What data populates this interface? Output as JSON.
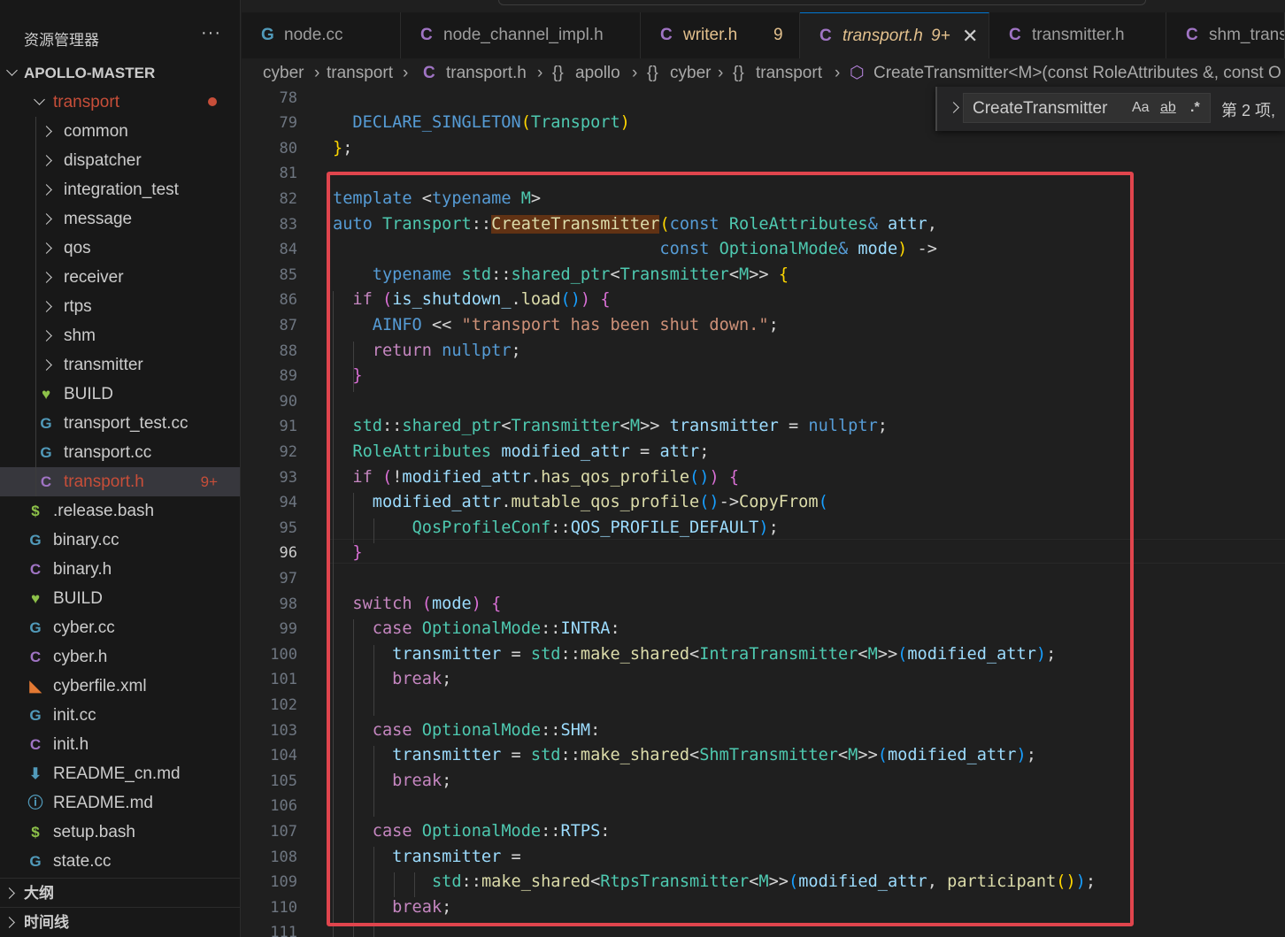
{
  "explorer": {
    "title": "资源管理器",
    "more": "···",
    "root": "APOLLO-MASTER",
    "items": [
      {
        "label": "transport",
        "icon": "folder-open",
        "badge": ""
      },
      {
        "label": "common",
        "icon": "folder",
        "badge": ""
      },
      {
        "label": "dispatcher",
        "icon": "folder",
        "badge": ""
      },
      {
        "label": "integration_test",
        "icon": "folder",
        "badge": ""
      },
      {
        "label": "message",
        "icon": "folder",
        "badge": ""
      },
      {
        "label": "qos",
        "icon": "folder",
        "badge": ""
      },
      {
        "label": "receiver",
        "icon": "folder",
        "badge": ""
      },
      {
        "label": "rtps",
        "icon": "folder",
        "badge": ""
      },
      {
        "label": "shm",
        "icon": "folder",
        "badge": ""
      },
      {
        "label": "transmitter",
        "icon": "folder",
        "badge": ""
      },
      {
        "label": "BUILD",
        "icon": "bazel",
        "badge": ""
      },
      {
        "label": "transport_test.cc",
        "icon": "cpp",
        "badge": ""
      },
      {
        "label": "transport.cc",
        "icon": "cpp",
        "badge": ""
      },
      {
        "label": "transport.h",
        "icon": "c-header",
        "badge": "9+"
      },
      {
        "label": ".release.bash",
        "icon": "bash",
        "badge": ""
      },
      {
        "label": "binary.cc",
        "icon": "cpp",
        "badge": ""
      },
      {
        "label": "binary.h",
        "icon": "c-header",
        "badge": ""
      },
      {
        "label": "BUILD",
        "icon": "bazel",
        "badge": ""
      },
      {
        "label": "cyber.cc",
        "icon": "cpp",
        "badge": ""
      },
      {
        "label": "cyber.h",
        "icon": "c-header",
        "badge": ""
      },
      {
        "label": "cyberfile.xml",
        "icon": "rss",
        "badge": ""
      },
      {
        "label": "init.cc",
        "icon": "cpp",
        "badge": ""
      },
      {
        "label": "init.h",
        "icon": "c-header",
        "badge": ""
      },
      {
        "label": "README_cn.md",
        "icon": "download",
        "badge": ""
      },
      {
        "label": "README.md",
        "icon": "info",
        "badge": ""
      },
      {
        "label": "setup.bash",
        "icon": "bash",
        "badge": ""
      },
      {
        "label": "state.cc",
        "icon": "cpp",
        "badge": ""
      }
    ],
    "outline": "大纲",
    "timeline": "时间线"
  },
  "tabs": [
    {
      "label": "node.cc",
      "icon": "cpp",
      "count": ""
    },
    {
      "label": "node_channel_impl.h",
      "icon": "c-header",
      "count": ""
    },
    {
      "label": "writer.h",
      "icon": "c-header",
      "count": "9"
    },
    {
      "label": "transport.h",
      "icon": "c-header",
      "count": "9+"
    },
    {
      "label": "transmitter.h",
      "icon": "c-header",
      "count": ""
    },
    {
      "label": "shm_trans",
      "icon": "c-header",
      "count": ""
    }
  ],
  "breadcrumb": [
    "cyber",
    "transport",
    "transport.h",
    "apollo",
    "cyber",
    "transport",
    "CreateTransmitter<M>(const RoleAttributes &, const O"
  ],
  "find": {
    "query": "CreateTransmitter",
    "opt_case": "Aa",
    "opt_word": "ab",
    "opt_regex": ".*",
    "result": "第 2 项,"
  },
  "editor": {
    "current_line": "96",
    "first_line": 78
  },
  "colors": {
    "accent": "#0078d4",
    "highlight_box": "#e0454d",
    "modified": "#e2c08d",
    "error_dot": "#c74e39"
  }
}
